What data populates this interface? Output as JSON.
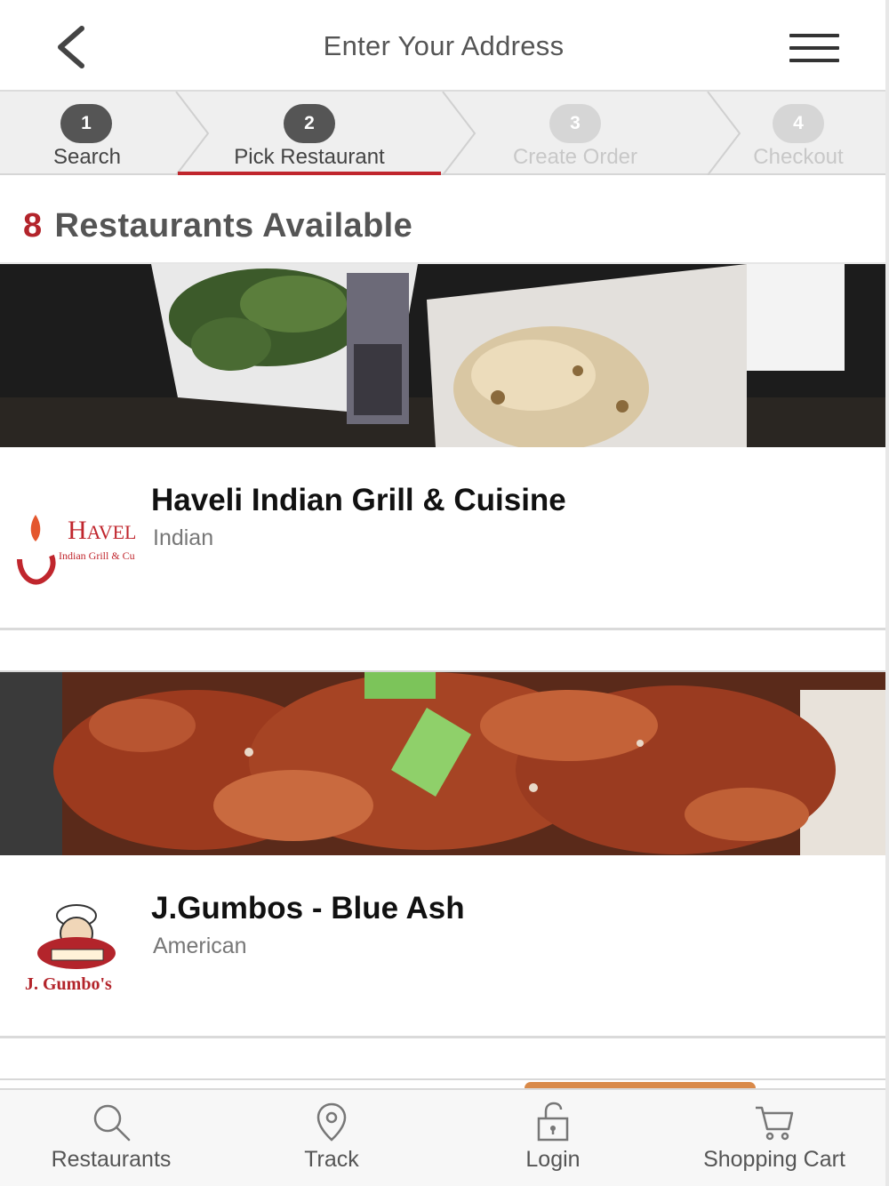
{
  "header": {
    "title": "Enter Your Address",
    "back_icon": "chevron-left-icon",
    "menu_icon": "hamburger-menu-icon"
  },
  "stepper": {
    "current_step": 2,
    "steps": [
      {
        "number": "1",
        "label": "Search"
      },
      {
        "number": "2",
        "label": "Pick Restaurant"
      },
      {
        "number": "3",
        "label": "Create Order"
      },
      {
        "number": "4",
        "label": "Checkout"
      }
    ]
  },
  "results": {
    "count": "8",
    "label": "Restaurants Available"
  },
  "restaurants": [
    {
      "name": "Haveli Indian Grill & Cuisine",
      "cuisine": "Indian",
      "logo": {
        "line1": "Haveli",
        "line2": "Indian Grill & Cuisine"
      }
    },
    {
      "name": "J.Gumbos - Blue Ash",
      "cuisine": "American",
      "logo": {
        "line1": "J. Gumbo's"
      }
    }
  ],
  "bottom_nav": [
    {
      "label": "Restaurants",
      "icon": "search-icon"
    },
    {
      "label": "Track",
      "icon": "location-pin-icon"
    },
    {
      "label": "Login",
      "icon": "unlock-icon"
    },
    {
      "label": "Shopping Cart",
      "icon": "cart-icon"
    }
  ],
  "colors": {
    "accent": "#b3242b",
    "active_step": "#555555",
    "inactive_step": "#d6d6d6"
  }
}
